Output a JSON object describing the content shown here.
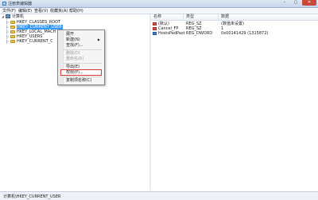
{
  "window": {
    "title": "注册表编辑器",
    "min": "–",
    "max": "▢",
    "close": "✕"
  },
  "menu": [
    "文件(F)",
    "编辑(E)",
    "查看(V)",
    "收藏夹(A)",
    "帮助(H)"
  ],
  "tree": {
    "root": "计算机",
    "items": [
      {
        "label": "HKEY_CLASSES_ROOT"
      },
      {
        "label": "HKEY_CURRENT_USER",
        "selected": true
      },
      {
        "label": "HKEY_LOCAL_MACH"
      },
      {
        "label": "HKEY_USERS"
      },
      {
        "label": "HKEY_CURRENT_C"
      }
    ]
  },
  "list": {
    "headers": [
      "名称",
      "类型",
      "数据"
    ],
    "rows": [
      {
        "name": "(默认)",
        "type": "REG_SZ",
        "data": "(数值未设置)",
        "icon": "string-value-icon"
      },
      {
        "name": "Cancel_FP",
        "type": "REG_SZ",
        "data": "1",
        "icon": "string-value-icon"
      },
      {
        "name": "HostsPadPast",
        "type": "REG_DWORD",
        "data": "0x00141429 (1315872)",
        "icon": "dword-value-icon"
      }
    ]
  },
  "context_menu": {
    "items": [
      {
        "label": "展开",
        "disabled": false
      },
      {
        "label": "新建(N)",
        "disabled": false,
        "submenu": true
      },
      {
        "label": "查找(F)...",
        "disabled": false
      },
      {
        "label": "删除(D)",
        "disabled": true
      },
      {
        "label": "重命名(R)",
        "disabled": true
      },
      {
        "label": "导出(E)",
        "disabled": false
      },
      {
        "label": "权限(P)...",
        "disabled": false,
        "highlighted": true
      },
      {
        "label": "复制项名称(C)",
        "disabled": false
      }
    ]
  },
  "status": "计算机\\HKEY_CURRENT_USER",
  "colors": {
    "selection": "#3399ff",
    "highlight_border": "#d93a3a",
    "close_button": "#c9483b"
  }
}
